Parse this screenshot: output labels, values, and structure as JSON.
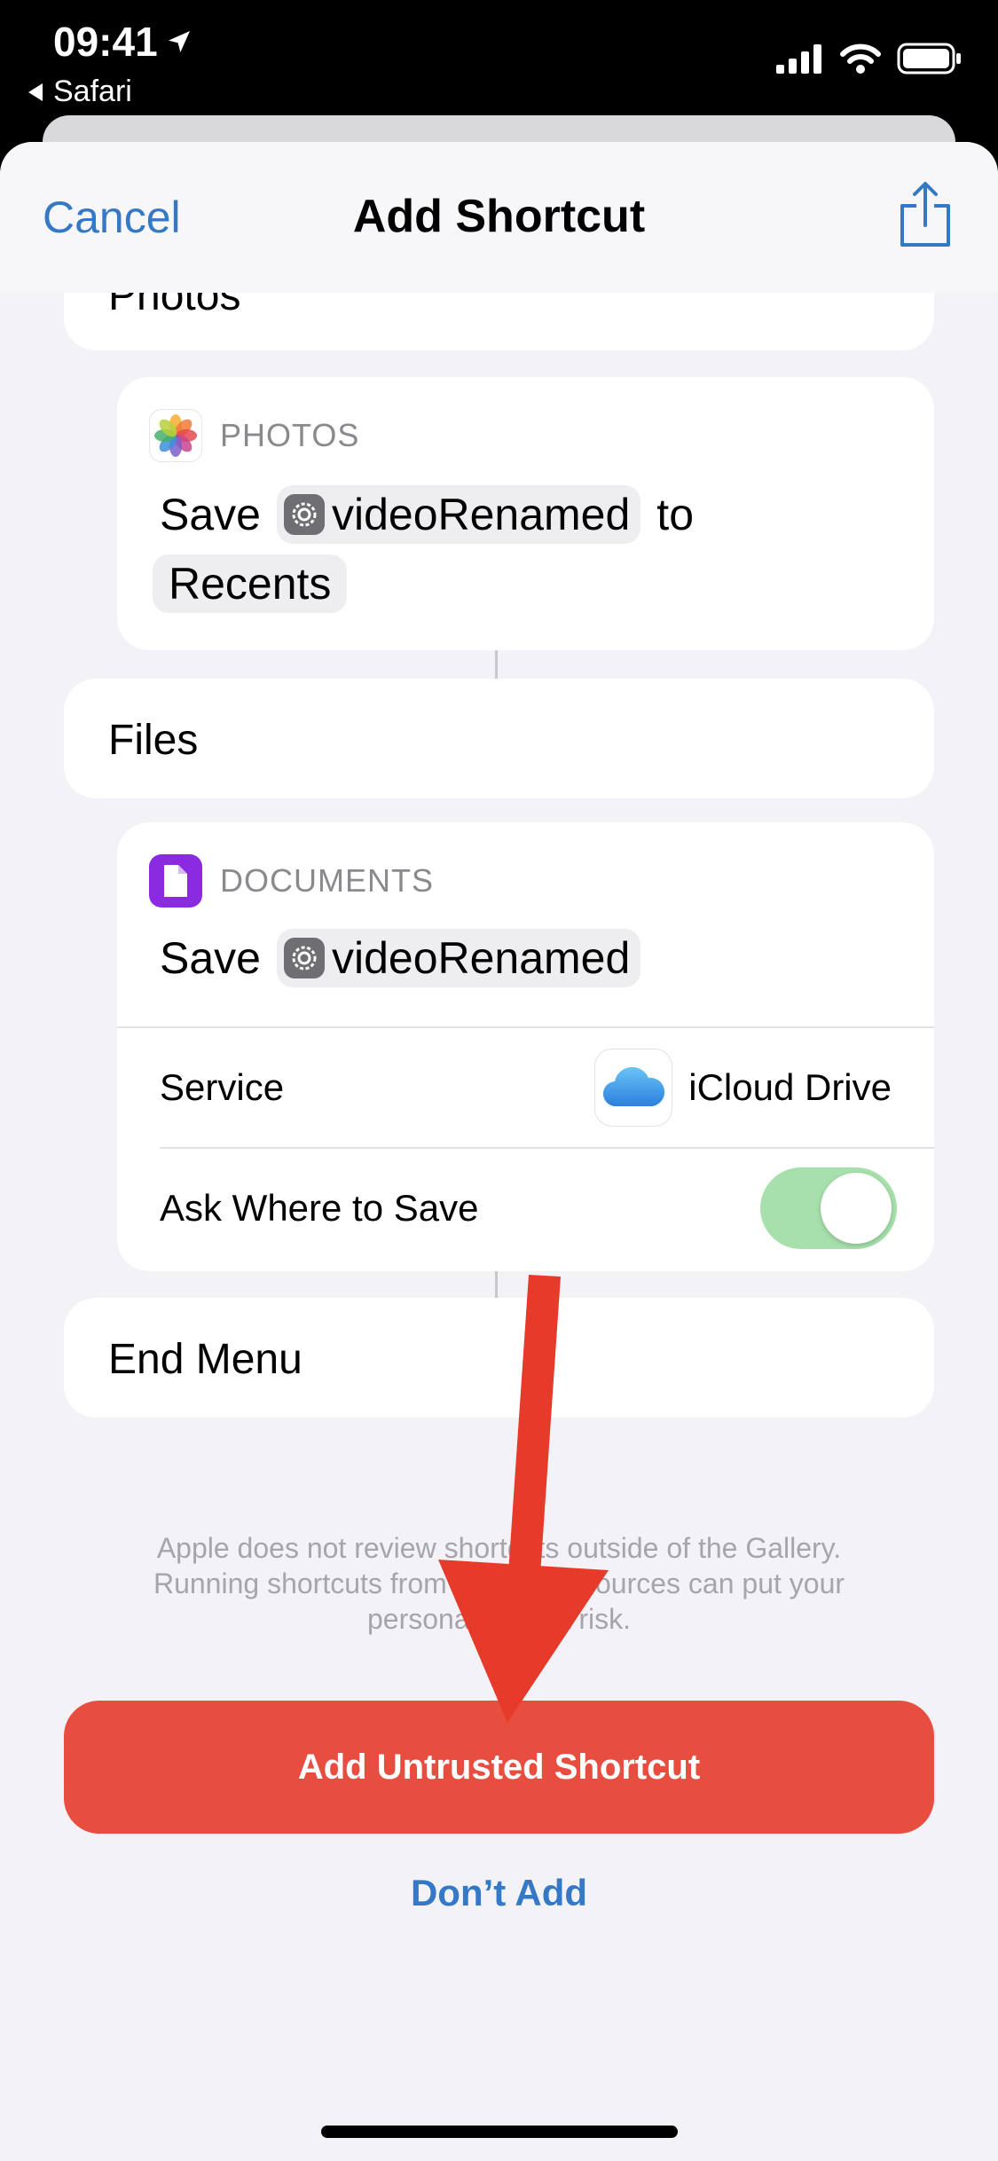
{
  "status": {
    "time": "09:41",
    "back_app": "Safari"
  },
  "nav": {
    "cancel": "Cancel",
    "title": "Add Shortcut",
    "share_icon": "share-icon"
  },
  "photos_menu_item": {
    "label": "Photos"
  },
  "photos_action": {
    "app_name": "PHOTOS",
    "verb": "Save",
    "variable": "videoRenamed",
    "preposition": "to",
    "album": "Recents"
  },
  "files_menu_item": {
    "label": "Files"
  },
  "documents_action": {
    "app_name": "DOCUMENTS",
    "verb": "Save",
    "variable": "videoRenamed",
    "service_label": "Service",
    "service_value": "iCloud Drive",
    "ask_label": "Ask Where to Save",
    "ask_enabled": true
  },
  "end_menu": {
    "label": "End Menu"
  },
  "disclaimer": {
    "line1": "Apple does not review shortcuts outside of the Gallery.",
    "line2": "Running shortcuts from untrusted sources can put your",
    "line3": "personal data at risk."
  },
  "buttons": {
    "add": "Add Untrusted Shortcut",
    "dont_add": "Don’t Add"
  },
  "colors": {
    "accent": "#3478c6",
    "danger": "#e84e3f",
    "arrow": "#e63b2a",
    "toggle_on": "#a7e0ad",
    "documents_icon": "#8a2be2"
  }
}
